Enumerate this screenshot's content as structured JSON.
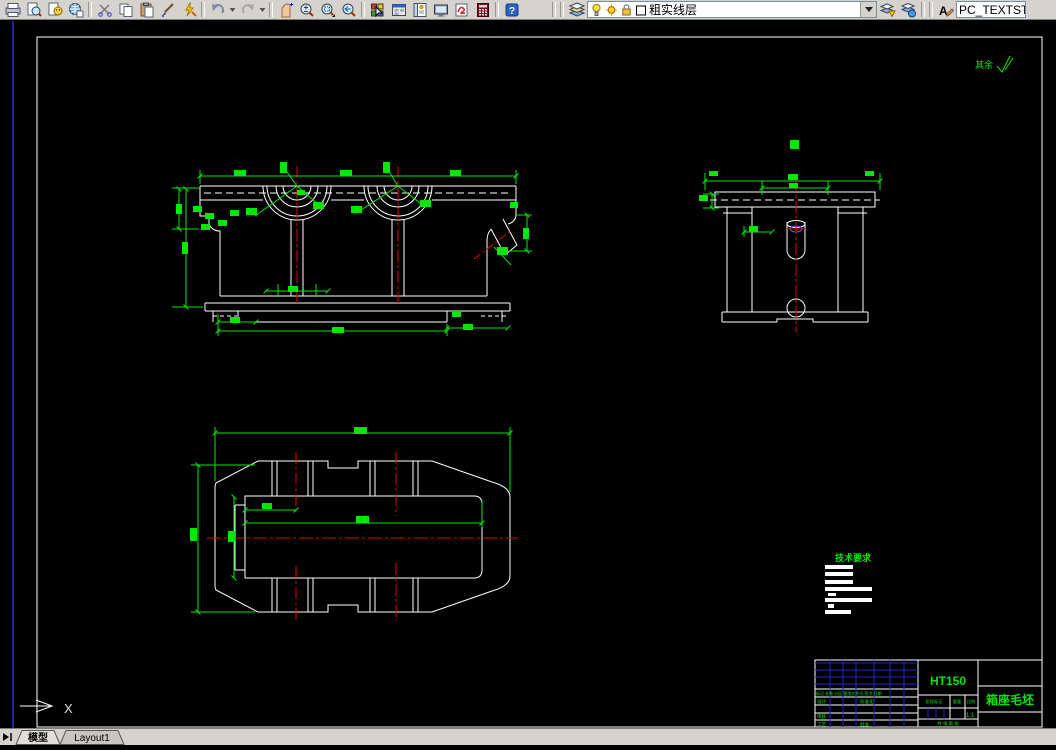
{
  "toolbar": {
    "layer_combo_value": "粗实线层",
    "style_combo_value": "PC_TEXTSTY",
    "glyph_help": "?",
    "glyph_text_style": "A",
    "icons": [
      "printer-icon",
      "page-magnifier-icon",
      "publish-page-icon",
      "globe-page-icon",
      "scissors-icon",
      "copy-pages-icon",
      "clipboard-paste-icon",
      "brush-icon",
      "lightning-pencil-icon",
      "undo-arrow-icon",
      "redo-arrow-icon",
      "pan-hand-icon",
      "zoom-realtime-icon",
      "zoom-window-icon",
      "zoom-previous-icon",
      "color-palette-icon",
      "design-center-icon",
      "tool-palettes-icon",
      "monitor-icon",
      "markup-icon",
      "calculator-icon",
      "help-icon",
      "layers-stack-icon",
      "bulb-icon",
      "sun-icon",
      "lock-icon",
      "color-swatch-icon",
      "layer-states-icon",
      "layer-previous-icon",
      "text-style-icon"
    ]
  },
  "drawing": {
    "surface_note": "其余",
    "tech_title": "技术要求",
    "ucs_axis": "X"
  },
  "title_block": {
    "material": "HT150",
    "part_name": "箱座毛坯",
    "scale_value": "1:1",
    "revision_header": "标记 处数 分区 更改文件号 签字 日期",
    "design": "设计",
    "standardization": "标准化",
    "check": "审核",
    "process": "工艺",
    "approve": "批准",
    "stage": "阶段标记",
    "weight": "重量",
    "scale": "比例",
    "sheets": "共 张 第 张"
  },
  "tabs": {
    "model": "模型",
    "layout": "Layout1"
  }
}
